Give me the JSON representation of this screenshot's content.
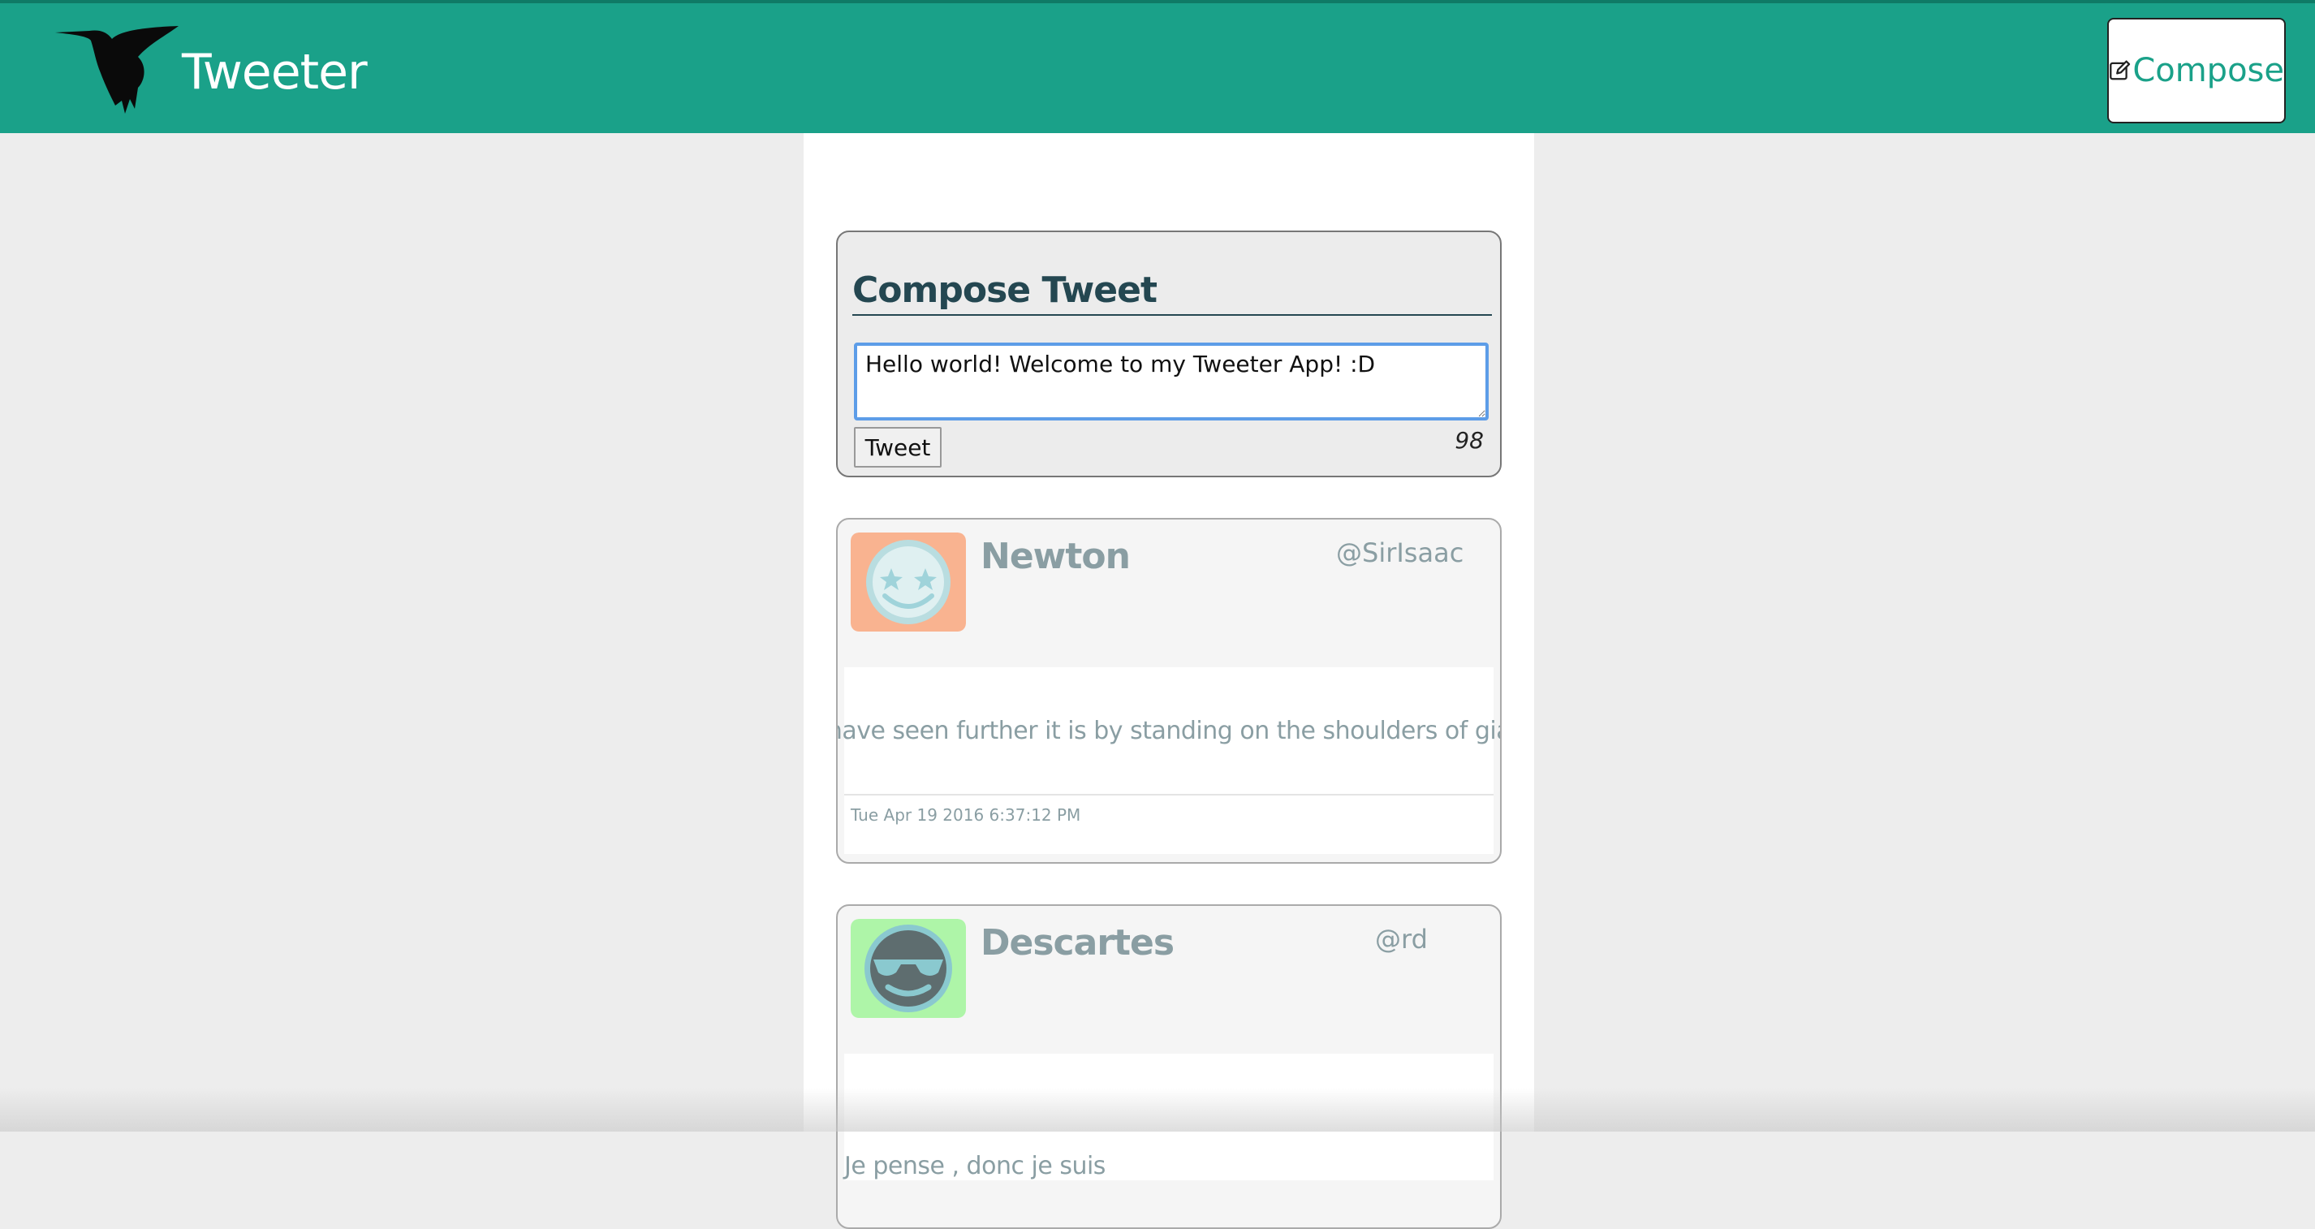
{
  "header": {
    "brand": "Tweeter",
    "compose_label": "Compose",
    "color": "#1aa189",
    "logo_icon": "hummingbird-icon",
    "compose_icon": "edit-icon"
  },
  "compose": {
    "title": "Compose Tweet",
    "text": "Hello world! Welcome to my Tweeter App! :D",
    "button_label": "Tweet",
    "counter": "98"
  },
  "tweets": [
    {
      "name": "Newton",
      "handle": "@SirIsaac",
      "content": "If I have seen further it is by standing on the shoulders of giants",
      "timestamp": "Tue Apr 19 2016 6:37:12 PM",
      "avatar_color": "#f9b390",
      "avatar_icon": "starry-eyed-smiley-icon"
    },
    {
      "name": "Descartes",
      "handle": "@rd",
      "content": "Je pense , donc je suis",
      "timestamp": "",
      "avatar_color": "#aef5a8",
      "avatar_icon": "sunglasses-smiley-icon"
    }
  ]
}
